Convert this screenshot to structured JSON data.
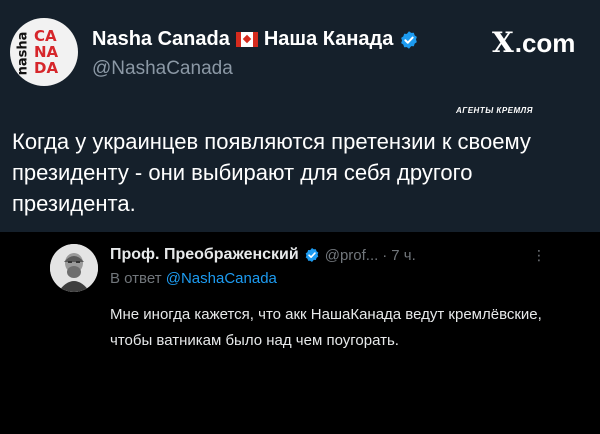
{
  "post": {
    "author_name": "Nasha Canada",
    "author_name_ru": "Наша Канада",
    "handle": "@NashaCanada",
    "logo_vertical_text": "nasha",
    "logo_stacked_text": "CA NA DA",
    "site_brand": "X",
    "site_brand_suffix": ".com",
    "watermark": "АГЕНТЫ КРЕМЛЯ",
    "text": "Когда у украинцев появляются претензии к своему президенту - они выбирают для себя другого президента."
  },
  "reply": {
    "author_name": "Проф. Преображенский",
    "handle": "@prof...",
    "separator": "·",
    "time": "7 ч.",
    "more_icon": "⋮",
    "replying_to_prefix": "В ответ",
    "replying_to_handle": "@NashaCanada",
    "text": "Мне иногда кажется, что акк НашаКанада ведут кремлёвские, чтобы ватникам было над чем поугорать."
  },
  "colors": {
    "top_background": "#15202b",
    "bottom_background": "#000000",
    "verified_blue": "#1d9bf0",
    "muted_text": "#71767b",
    "logo_red": "#d6262b"
  },
  "icons": [
    "verified-badge-icon",
    "canada-flag-icon",
    "more-options-icon"
  ]
}
